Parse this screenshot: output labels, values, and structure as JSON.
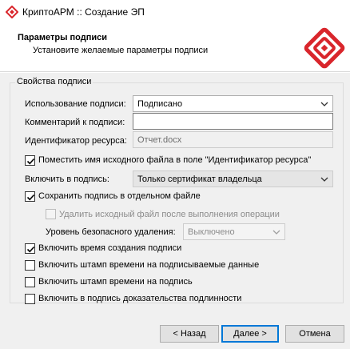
{
  "window": {
    "title": "КриптоАРМ :: Создание ЭП"
  },
  "header": {
    "title": "Параметры подписи",
    "subtitle": "Установите желаемые параметры подписи"
  },
  "group": {
    "label": "Свойства подписи"
  },
  "form": {
    "usage_label": "Использование подписи:",
    "usage_value": "Подписано",
    "comment_label": "Комментарий к подписи:",
    "comment_value": "",
    "resource_label": "Идентификатор ресурса:",
    "resource_value": "Отчет.docx",
    "put_filename_label": "Поместить имя исходного файла в поле \"Идентификатор ресурса\"",
    "put_filename_checked": true,
    "include_label": "Включить в подпись:",
    "include_value": "Только сертификат владельца",
    "save_separate_label": "Сохранить подпись в отдельном файле",
    "save_separate_checked": true,
    "delete_source_label": "Удалить исходный файл после выполнения операции",
    "delete_source_checked": false,
    "secure_delete_label": "Уровень безопасного удаления:",
    "secure_delete_value": "Выключено",
    "include_time_label": "Включить время создания подписи",
    "include_time_checked": true,
    "timestamp_data_label": "Включить штамп времени на подписываемые данные",
    "timestamp_data_checked": false,
    "timestamp_sig_label": "Включить штамп времени на подпись",
    "timestamp_sig_checked": false,
    "evidence_label": "Включить в подпись доказательства подлинности",
    "evidence_checked": false
  },
  "buttons": {
    "back": "< Назад",
    "next": "Далее >",
    "cancel": "Отмена"
  },
  "icons": {
    "app": "kriptoarm-app-icon",
    "logo": "kriptoarm-logo",
    "dropdown": "chevron-down-icon",
    "check": "checkmark-icon"
  },
  "colors": {
    "brand_red": "#d9262c",
    "focus_blue": "#0078d7",
    "dialog_bg": "#f0f0f0"
  }
}
